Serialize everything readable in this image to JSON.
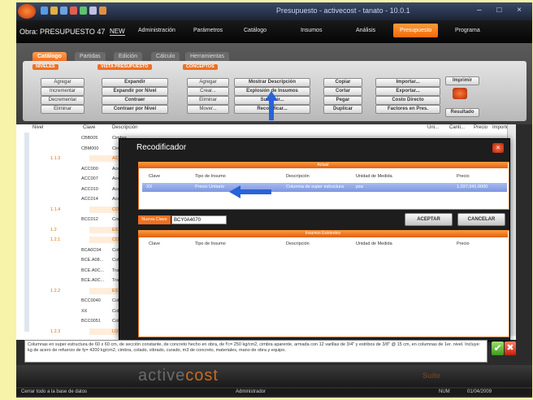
{
  "window": {
    "title": "Presupuesto - activecost - tanato - 10.0.1",
    "controls": "– □ ×"
  },
  "menubar": {
    "obra_label": "Obra: PRESUPUESTO 47",
    "obra_code": "NEW",
    "items": [
      "Administración",
      "Parámetros",
      "Catálogo",
      "Insumos",
      "Análisis",
      "Presupuesto",
      "Programa"
    ],
    "active_index": 5
  },
  "ribbon": {
    "tabs": [
      "Catálogo",
      "Partidas",
      "Edición",
      "Cálculo",
      "Herramientas"
    ],
    "groups": {
      "niveles": "NIVELES",
      "vista_presupuesto": "VISTA PRESUPUESTO",
      "conceptos": "CONCEPTOS"
    },
    "buttons": {
      "agregar": "Agregar",
      "incrementar": "Incrementar",
      "decrementar": "Decrementar",
      "eliminar_nivel": "Eliminar",
      "expandir": "Expandir",
      "expandir_nivel": "Expandir por Nivel",
      "contraer": "Contraer",
      "contraer_nivel": "Contraer por Nivel",
      "agregar_c": "Agregar",
      "crear": "Crear...",
      "eliminar_c": "Eliminar",
      "mover": "Mover...",
      "mostrar_descripcion": "Mostrar Descripción",
      "explosion_insumos": "Explosión de Insumos",
      "sustituir": "Sustituir...",
      "recodificar": "Recodificar...",
      "copiar": "Copiar",
      "cortar": "Cortar",
      "pegar": "Pegar",
      "duplicar": "Duplicar",
      "importar": "Importar...",
      "exportar": "Exportar...",
      "costo_directo": "Costo Directo",
      "factores_pres": "Factores en Pres.",
      "imprimir": "Imprimir",
      "resultado": "Resultado"
    }
  },
  "grid": {
    "headers": [
      "Nivel",
      "Clave",
      "Descripción",
      "Uni...",
      "Canti...",
      "Precio",
      "Importe"
    ],
    "rows": [
      {
        "nivel": "",
        "clave": "CBB005",
        "desc": "Cimbra"
      },
      {
        "nivel": "",
        "clave": "CBM000",
        "desc": "Cimbra"
      },
      {
        "nivel": "1.1.3",
        "clave": "",
        "desc": "ACERO"
      },
      {
        "nivel": "",
        "clave": "ACC000",
        "desc": "Acero"
      },
      {
        "nivel": "",
        "clave": "ACC007",
        "desc": "Acero"
      },
      {
        "nivel": "",
        "clave": "ACC010",
        "desc": "Acero"
      },
      {
        "nivel": "",
        "clave": "ACC014",
        "desc": "Acero"
      },
      {
        "nivel": "1.1.4",
        "clave": "",
        "desc": "CONCR"
      },
      {
        "nivel": "",
        "clave": "BCC012",
        "desc": "Concre"
      },
      {
        "nivel": "1.2",
        "clave": "",
        "desc": "ESTRUC"
      },
      {
        "nivel": "1.2.1",
        "clave": "",
        "desc": "COLUM"
      },
      {
        "nivel": "",
        "clave": "BCA0C04",
        "desc": "Columna"
      },
      {
        "nivel": "",
        "clave": "BCE.A08...",
        "desc": "Columna"
      },
      {
        "nivel": "",
        "clave": "BCE.A0C...",
        "desc": "Trabe"
      },
      {
        "nivel": "",
        "clave": "BCE.A0C...",
        "desc": "Trabe"
      },
      {
        "nivel": "1.2.2",
        "clave": "",
        "desc": "ESTRUC"
      },
      {
        "nivel": "",
        "clave": "BCC0040",
        "desc": "Columna"
      },
      {
        "nivel": "",
        "clave": "XX",
        "desc": "Columna"
      },
      {
        "nivel": "",
        "clave": "BCC0051",
        "desc": "Columna"
      },
      {
        "nivel": "1.2.3",
        "clave": "",
        "desc": "LOSAS"
      }
    ]
  },
  "dialog": {
    "title": "Recodificador",
    "close": "×",
    "actual_header": "Actual",
    "columns": [
      "Clave",
      "Tipo de Insumo",
      "Descripción",
      "Unidad de Medida",
      "Precio"
    ],
    "row": {
      "clave": "XX",
      "tipo": "Precio Unitario",
      "descripcion": "Columna de super estructura",
      "unidad": "pza",
      "precio": "1,037,941.0000"
    },
    "nueva_clave_label": "Nueva Clave",
    "nueva_clave_value": "BCY0A4070",
    "aceptar": "ACEPTAR",
    "cancelar": "CANCELAR",
    "existentes_header": "Insumos Existentes"
  },
  "description_text": "Columnas en super estructura de 60 x 60 cm, de sección constante, de concreto hecho en obra, de f'c= 250 kg/cm2, cimbra aparente, armada con 12 varillas de 3/4\" y estribos de 3/8\" @ 15 cm, en columnas de 1er. nivel. Incluye: kg de acero de refuerzo de fy= 4200 kg/cm2, cimbra, colado, vibrado, curado, m3 de concreto, materiales, mano de obra y equipo.",
  "brand": {
    "part1": "active",
    "part2": "cost",
    "tagline": "Suite"
  },
  "statusbar": {
    "left": "Cerrar todo a la base de datos",
    "center": "Administrador",
    "right1": "NUM",
    "right2": "01/04/2009"
  },
  "colors": {
    "accent_orange": "#f07020",
    "selection_blue": "#7c96e0",
    "arrow_blue": "#2a62d8"
  }
}
